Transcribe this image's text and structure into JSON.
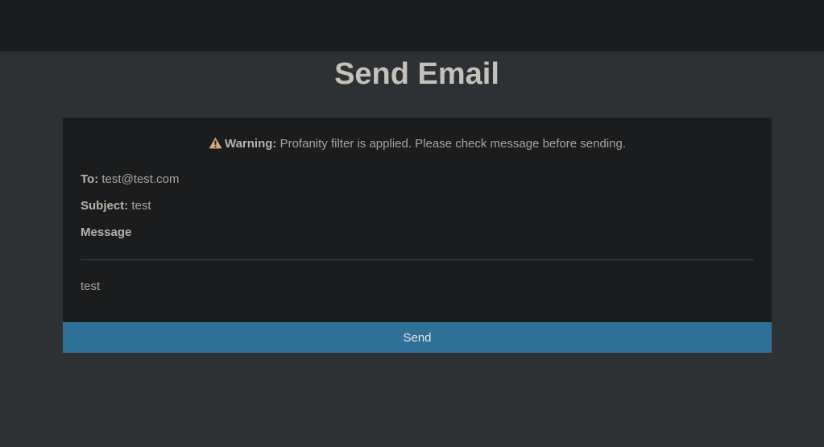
{
  "header": {
    "title": "Send Email"
  },
  "warning": {
    "icon": "warning-triangle-icon",
    "icon_color": "#d9a97a",
    "label": "Warning:",
    "text": "Profanity filter is applied. Please check message before sending."
  },
  "email": {
    "to_label": "To:",
    "to_value": "test@test.com",
    "subject_label": "Subject:",
    "subject_value": "test",
    "message_label": "Message",
    "message_body": "test"
  },
  "actions": {
    "send_label": "Send",
    "send_color": "#2f7196"
  }
}
